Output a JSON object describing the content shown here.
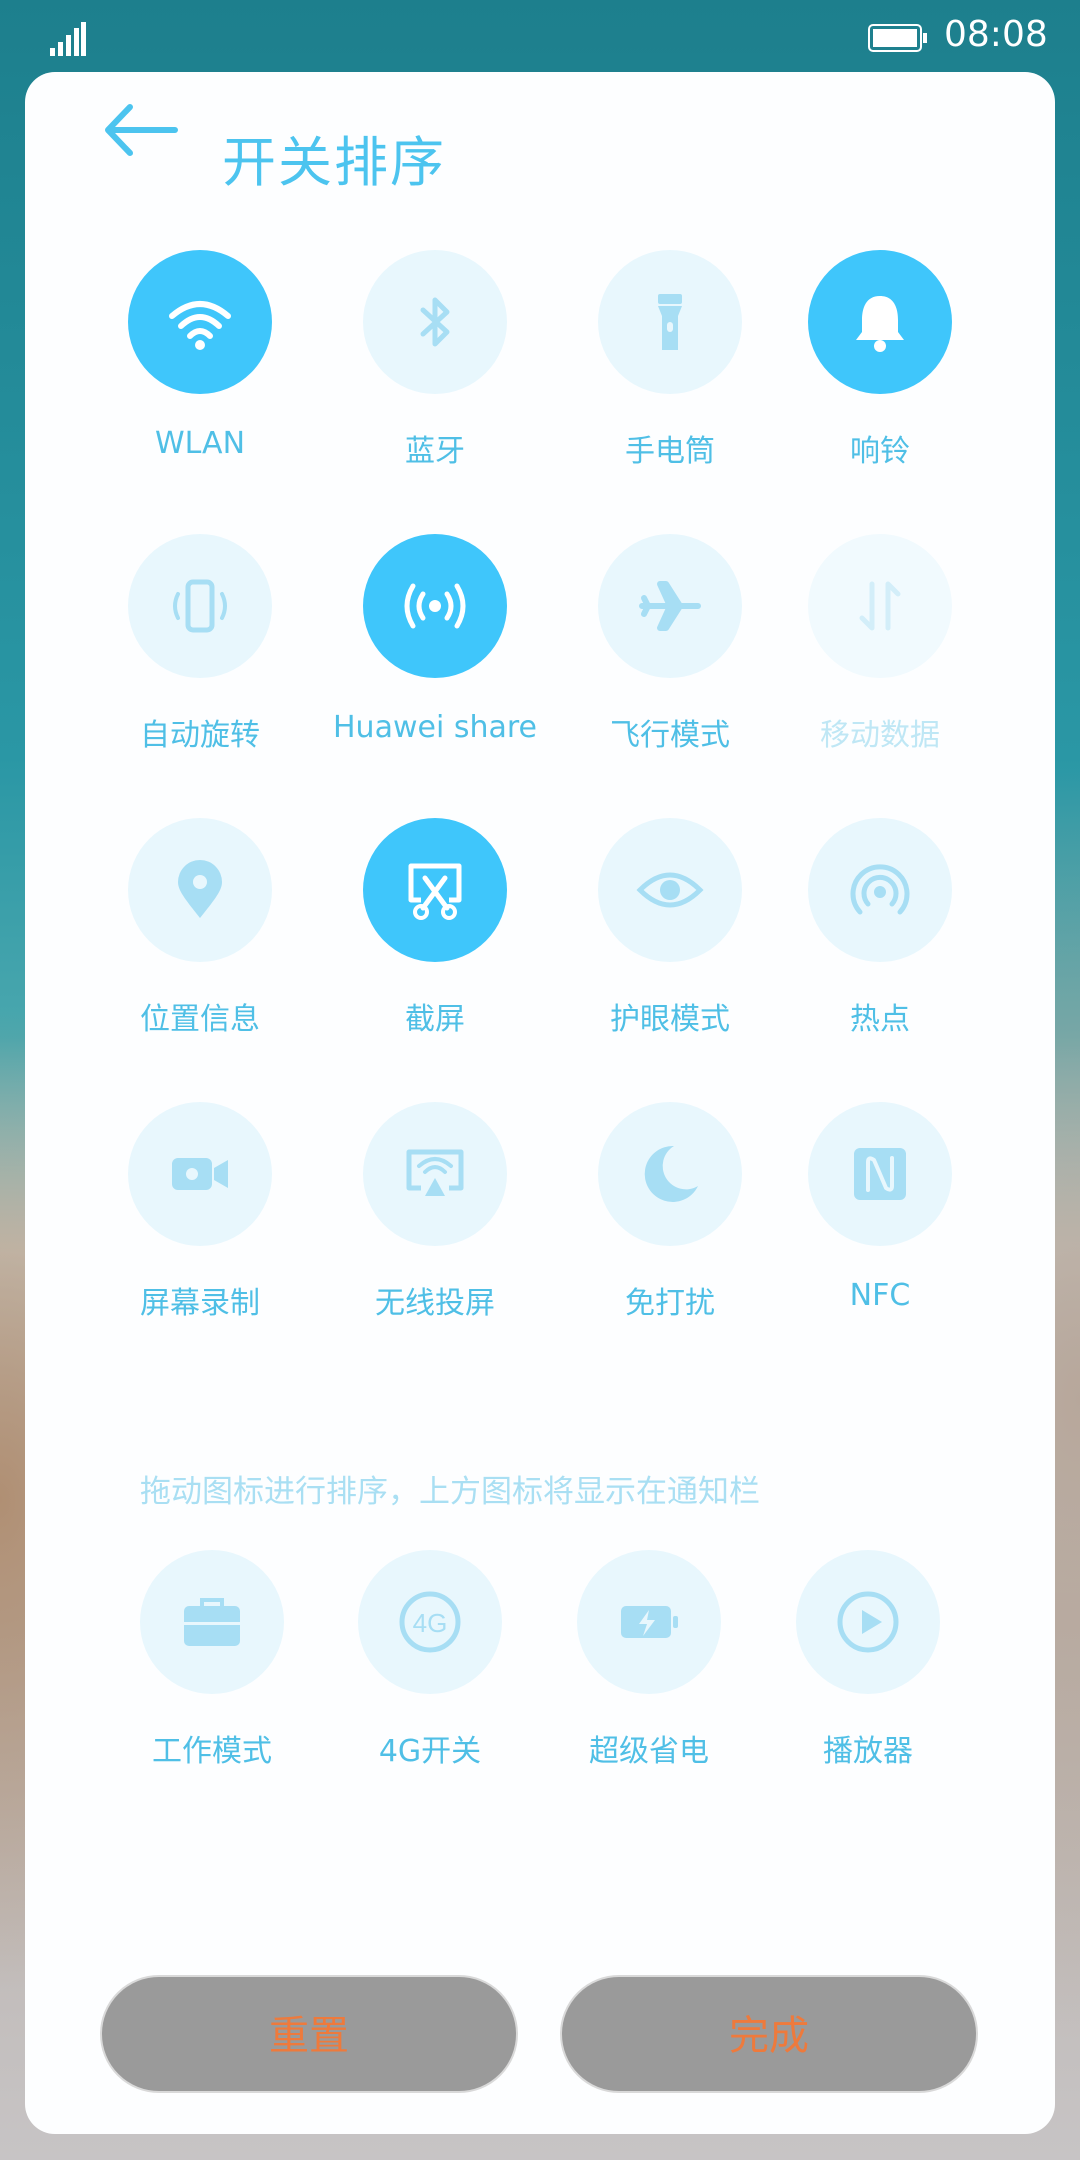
{
  "status_bar": {
    "time": "08:08"
  },
  "header": {
    "title": "开关排序"
  },
  "active_tiles": [
    {
      "label": "WLAN",
      "icon": "wifi-icon",
      "on": true
    },
    {
      "label": "蓝牙",
      "icon": "bluetooth-icon",
      "on": false
    },
    {
      "label": "手电筒",
      "icon": "flashlight-icon",
      "on": false
    },
    {
      "label": "响铃",
      "icon": "bell-icon",
      "on": true
    },
    {
      "label": "自动旋转",
      "icon": "auto-rotate-icon",
      "on": false
    },
    {
      "label": "Huawei share",
      "icon": "huawei-share-icon",
      "on": true
    },
    {
      "label": "飞行模式",
      "icon": "airplane-icon",
      "on": false
    },
    {
      "label": "移动数据",
      "icon": "mobile-data-icon",
      "on": false,
      "disabled": true
    },
    {
      "label": "位置信息",
      "icon": "location-icon",
      "on": false
    },
    {
      "label": "截屏",
      "icon": "screenshot-icon",
      "on": true
    },
    {
      "label": "护眼模式",
      "icon": "eye-icon",
      "on": false
    },
    {
      "label": "热点",
      "icon": "hotspot-icon",
      "on": false
    },
    {
      "label": "屏幕录制",
      "icon": "screen-record-icon",
      "on": false
    },
    {
      "label": "无线投屏",
      "icon": "wireless-projection-icon",
      "on": false
    },
    {
      "label": "免打扰",
      "icon": "moon-icon",
      "on": false
    },
    {
      "label": "NFC",
      "icon": "nfc-icon",
      "on": false
    }
  ],
  "hint": "拖动图标进行排序，上方图标将显示在通知栏",
  "inactive_tiles": [
    {
      "label": "工作模式",
      "icon": "briefcase-icon"
    },
    {
      "label": "4G开关",
      "icon": "4g-icon"
    },
    {
      "label": "超级省电",
      "icon": "battery-saver-icon"
    },
    {
      "label": "播放器",
      "icon": "player-icon"
    }
  ],
  "buttons": {
    "reset": "重置",
    "done": "完成"
  },
  "colors": {
    "accent": "#3fc6fb",
    "tile_bg": "#e8f7fd",
    "label": "#4fbfe6",
    "button_bg": "#9a9a9a",
    "button_text": "#ee7a3c"
  }
}
